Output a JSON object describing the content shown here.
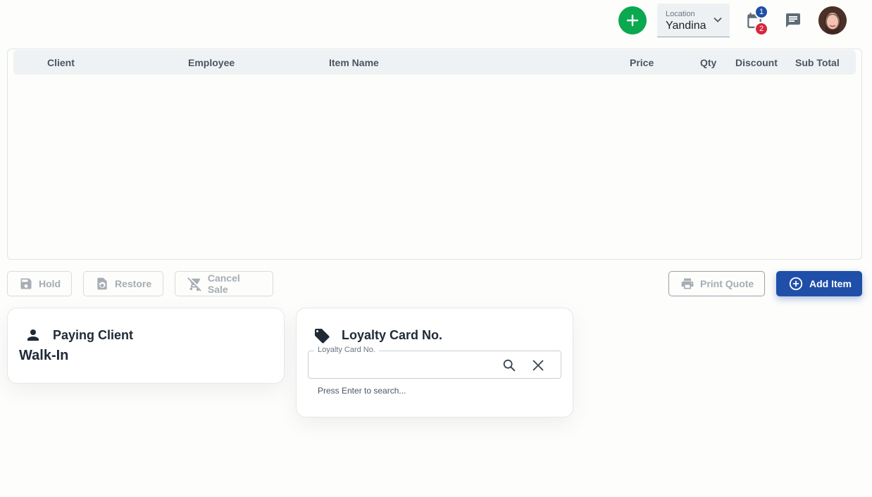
{
  "header": {
    "location_label": "Location",
    "location_value": "Yandina",
    "calendar_badges": [
      "1",
      "2"
    ]
  },
  "table": {
    "columns": [
      "Client",
      "Employee",
      "Item Name",
      "Price",
      "Qty",
      "Discount",
      "Sub Total"
    ],
    "rows": []
  },
  "actions": {
    "hold": "Hold",
    "restore": "Restore",
    "cancel_sale": "Cancel Sale",
    "print_quote": "Print Quote",
    "add_item": "Add Item"
  },
  "paying_client": {
    "title": "Paying Client",
    "value": "Walk-In"
  },
  "loyalty": {
    "title": "Loyalty Card No.",
    "field_label": "Loyalty Card No.",
    "value": "",
    "hint": "Press Enter to search..."
  },
  "colors": {
    "primary": "#1f4fa8",
    "success": "#0aa84f",
    "danger": "#d6263b"
  },
  "icons": [
    "add-icon",
    "chevron-down-icon",
    "calendar-icon",
    "chat-icon",
    "save-icon",
    "restore-icon",
    "cart-off-icon",
    "print-icon",
    "add-circle-icon",
    "person-icon",
    "tag-icon",
    "search-icon",
    "close-icon"
  ]
}
